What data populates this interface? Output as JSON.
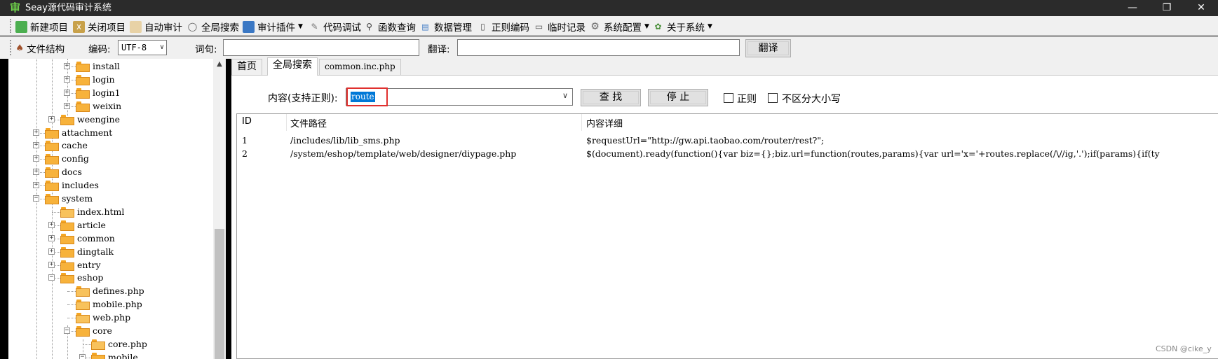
{
  "window": {
    "title": "Seay源代码审计系统",
    "app_icon": "审",
    "minimize_glyph": "—",
    "maximize_glyph": "❐",
    "close_glyph": "✕"
  },
  "toolbar": {
    "items": [
      {
        "label": "新建项目",
        "icon": "new-project-icon"
      },
      {
        "label": "关闭项目",
        "icon": "close-project-icon"
      },
      {
        "label": "自动审计",
        "icon": "auto-audit-icon"
      },
      {
        "label": "全局搜索",
        "icon": "global-search-icon"
      },
      {
        "label": "审计插件",
        "icon": "plugin-icon",
        "dropdown": true
      },
      {
        "label": "代码调试",
        "icon": "debug-icon"
      },
      {
        "label": "函数查询",
        "icon": "function-search-icon"
      },
      {
        "label": "数据管理",
        "icon": "data-manage-icon"
      },
      {
        "label": "正则编码",
        "icon": "regex-encode-icon"
      },
      {
        "label": "临时记录",
        "icon": "temp-record-icon"
      },
      {
        "label": "系统配置",
        "icon": "gear-icon",
        "dropdown": true
      },
      {
        "label": "关于系统",
        "icon": "about-icon",
        "dropdown": true
      }
    ]
  },
  "toolbar2": {
    "file_structure_label": "文件结构",
    "encoding_label": "编码:",
    "encoding_value": "UTF-8",
    "word_label": "词句:",
    "word_value": "",
    "translate_label": "翻译:",
    "translate_value": "",
    "translate_button": "翻译"
  },
  "tree": {
    "scroll_up": "▲",
    "nodes": [
      {
        "label": "install",
        "level": 3,
        "expandable": true
      },
      {
        "label": "login",
        "level": 3,
        "expandable": true
      },
      {
        "label": "login1",
        "level": 3,
        "expandable": true
      },
      {
        "label": "weixin",
        "level": 3,
        "expandable": true
      },
      {
        "label": "weengine",
        "level": 2,
        "expandable": true
      },
      {
        "label": "attachment",
        "level": 1,
        "expandable": true
      },
      {
        "label": "cache",
        "level": 1,
        "expandable": true
      },
      {
        "label": "config",
        "level": 1,
        "expandable": true
      },
      {
        "label": "docs",
        "level": 1,
        "expandable": true
      },
      {
        "label": "includes",
        "level": 1,
        "expandable": true
      },
      {
        "label": "system",
        "level": 1,
        "expandable": true,
        "expanded": true
      },
      {
        "label": "index.html",
        "level": 2,
        "expandable": false
      },
      {
        "label": "article",
        "level": 2,
        "expandable": true
      },
      {
        "label": "common",
        "level": 2,
        "expandable": true
      },
      {
        "label": "dingtalk",
        "level": 2,
        "expandable": true
      },
      {
        "label": "entry",
        "level": 2,
        "expandable": true
      },
      {
        "label": "eshop",
        "level": 2,
        "expandable": true,
        "expanded": true
      },
      {
        "label": "defines.php",
        "level": 3,
        "expandable": false
      },
      {
        "label": "mobile.php",
        "level": 3,
        "expandable": false
      },
      {
        "label": "web.php",
        "level": 3,
        "expandable": false
      },
      {
        "label": "core",
        "level": 3,
        "expandable": true,
        "expanded": true
      },
      {
        "label": "core.php",
        "level": 4,
        "expandable": false
      },
      {
        "label": "mobile",
        "level": 4,
        "expandable": true,
        "expanded": true
      }
    ]
  },
  "tabs": [
    {
      "label": "首页",
      "active": false
    },
    {
      "label": "全局搜索",
      "active": true
    },
    {
      "label": "common.inc.php",
      "active": false
    }
  ],
  "search": {
    "content_label": "内容(支持正则):",
    "query": "route",
    "find_button": "查 找",
    "stop_button": "停 止",
    "regex_label": "正则",
    "regex_checked": false,
    "case_label": "不区分大小写",
    "case_checked": false
  },
  "results": {
    "columns": [
      "ID",
      "文件路径",
      "内容详细"
    ],
    "rows": [
      {
        "id": "1",
        "path": "/includes/lib/lib_sms.php",
        "detail": "$requestUrl=\"http://gw.api.taobao.com/router/rest?\";"
      },
      {
        "id": "2",
        "path": "/system/eshop/template/web/designer/diypage.php",
        "detail": "$(document).ready(function(){var biz={};biz.url=function(routes,params){var url='x='+routes.replace(/\\//ig,'.');if(params){if(ty"
      }
    ]
  },
  "watermark": "CSDN @cike_y",
  "colors": {
    "titlebar": "#2b2b2b",
    "toolbar": "#f0f0f0",
    "selection": "#0078d7",
    "highlight_box": "#e0302e"
  }
}
